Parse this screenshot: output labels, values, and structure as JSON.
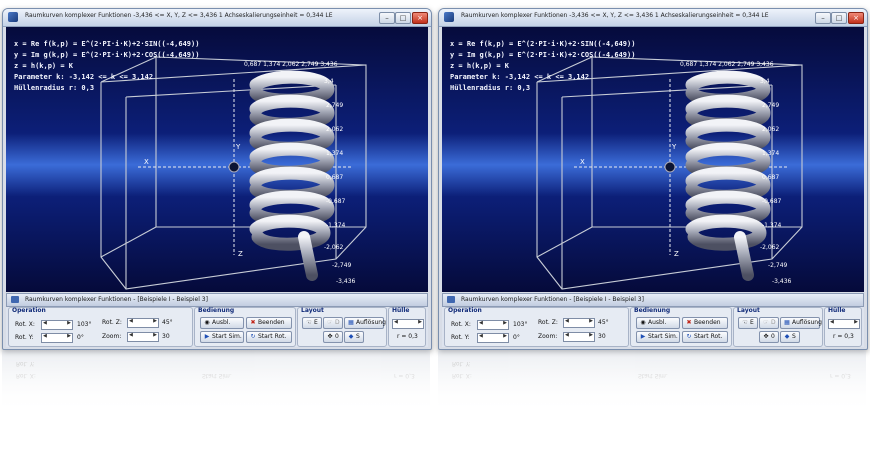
{
  "window": {
    "title": "Raumkurven komplexer Funktionen  -3,436 <= X, Y, Z <= 3,436  1 Achseskalierungseinheit = 0,344 LE",
    "statusbar": "Raumkurven komplexer Funktionen - [Beispiele I - Beispiel 3]"
  },
  "formulas": [
    "x = Re f(k,p) = E^(2·PI·i·K)+2·SIN((-4,649))",
    "y = Im g(k,p) = E^(2·PI·i·K)+2·COS((-4,649))",
    "z = h(k,p) = K",
    "Parameter k: -3,142 <= k <= 3,142",
    "Hüllenradius r: 0,3"
  ],
  "axes": {
    "x": "X",
    "y": "Y",
    "z": "Z"
  },
  "tick_labels_right": [
    "3,4",
    "2,749",
    "2,062",
    "1,374",
    "0,687",
    "-0,687",
    "-1,374",
    "-2,062",
    "-2,749",
    "-3,436"
  ],
  "tick_labels_top": "0,687  1,374  2,062  2,749  3,436",
  "panel": {
    "operation": {
      "header": "Operation",
      "rot_x_label": "Rot. X:",
      "rot_x_value": "103°",
      "rot_y_label": "Rot. Y:",
      "rot_y_value": "0°",
      "rot_z_label": "Rot. Z:",
      "rot_z_value": "45°",
      "zoom_label": "Zoom:",
      "zoom_value": "30"
    },
    "bedienung": {
      "header": "Bedienung",
      "ausbl": "Ausbl.",
      "beenden": "Beenden",
      "start_sim": "Start Sim.",
      "start_rot": "Start Rot."
    },
    "layout": {
      "header": "Layout",
      "e": "E",
      "d": "D",
      "aufloesung": "Auflösung",
      "o": "0",
      "s": "S"
    },
    "huelle": {
      "header": "Hülle",
      "radius": "r = 0,3"
    }
  },
  "colors": {
    "title_accent": "#102a78",
    "scene_blue": "#0c1f78",
    "coil": "#b9bdc9"
  }
}
